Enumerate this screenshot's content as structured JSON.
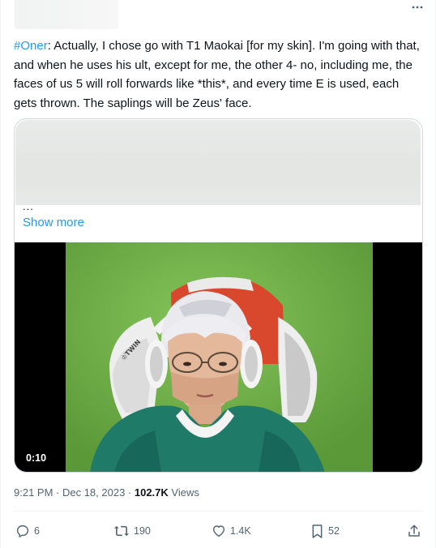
{
  "tweet": {
    "hashtag": "#Oner",
    "text": ": Actually, I chose go with T1 Maokai [for my skin]. I'm going with that, and when he uses his ult, except for me, the other 4- no, including me, the faces of us 5 will roll forwards like *this*, and every time E is used, each gets thrown. The saplings will be Zeus' face."
  },
  "quoted_card": {
    "ellipsis": "...",
    "show_more_label": "Show more"
  },
  "video": {
    "duration": "0:10",
    "chair_brand": "♔TWIN"
  },
  "meta": {
    "timestamp": "9:21 PM · Dec 18, 2023 · ",
    "views_count": "102.7K",
    "views_label": " Views"
  },
  "actions": {
    "replies": "6",
    "reposts": "190",
    "likes": "1.4K",
    "bookmarks": "52"
  },
  "colors": {
    "accent": "#1d9bf0",
    "text": "#0f1419",
    "muted": "#536471",
    "border": "#cfd9de"
  },
  "icons": {
    "more": "more-horizontal-icon",
    "reply": "reply-icon",
    "repost": "repost-icon",
    "like": "heart-icon",
    "bookmark": "bookmark-icon",
    "share": "share-icon"
  }
}
